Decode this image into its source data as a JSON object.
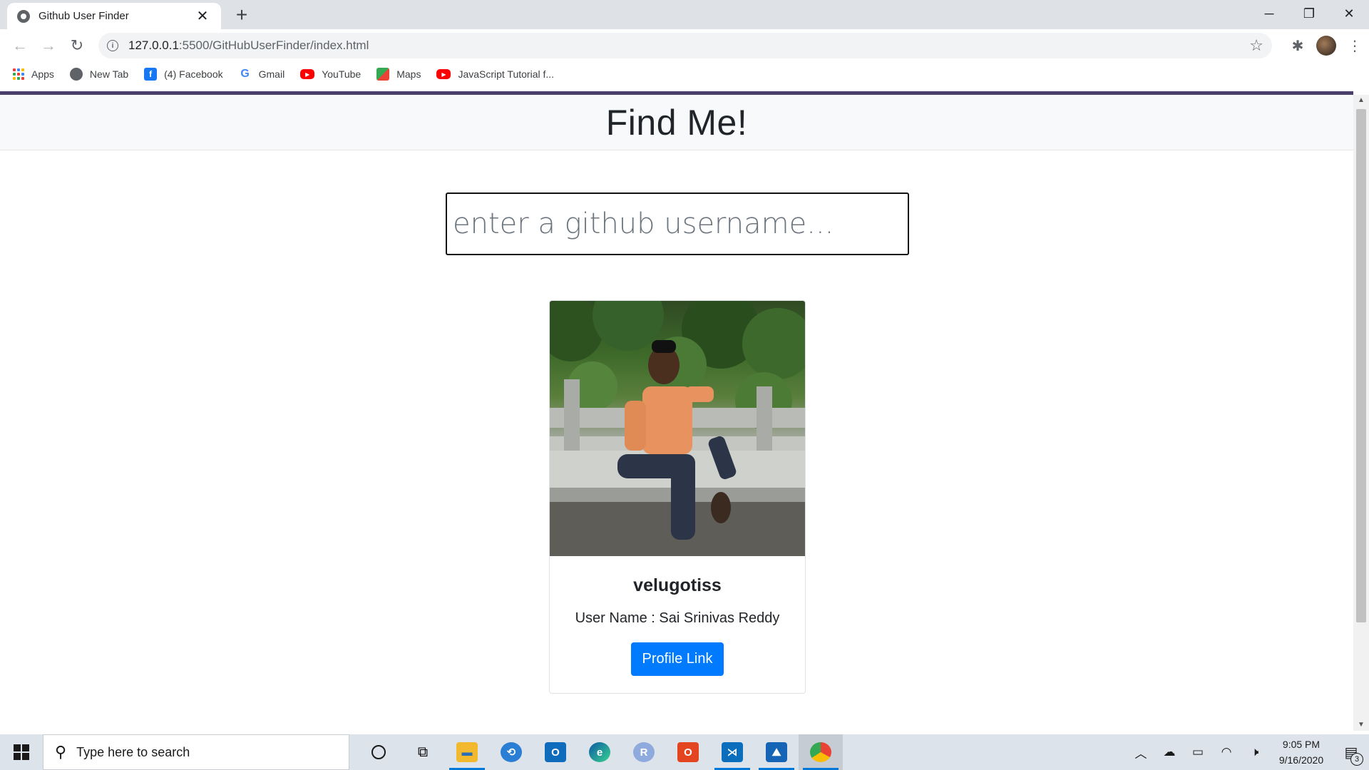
{
  "browser": {
    "tab_title": "Github User Finder",
    "tab_close": "✕",
    "new_tab": "+",
    "url_host": "127.0.0.1",
    "url_path": ":5500/GitHubUserFinder/index.html",
    "window_controls": [
      "─",
      "❐",
      "✕"
    ]
  },
  "bookmarks": [
    {
      "label": "Apps",
      "icon": "apps-grid-icon"
    },
    {
      "label": "New Tab",
      "icon": "globe-icon"
    },
    {
      "label": "(4) Facebook",
      "icon": "facebook-icon"
    },
    {
      "label": "Gmail",
      "icon": "google-icon"
    },
    {
      "label": "YouTube",
      "icon": "youtube-icon"
    },
    {
      "label": "Maps",
      "icon": "maps-icon"
    },
    {
      "label": "JavaScript Tutorial f...",
      "icon": "youtube-icon"
    }
  ],
  "page": {
    "title": "Find Me!",
    "search_placeholder": "enter a github username...",
    "search_value": "",
    "card": {
      "login": "velugotiss",
      "user_name": "User Name : Sai Srinivas Reddy",
      "button_label": "Profile Link"
    }
  },
  "taskbar": {
    "search_placeholder": "Type here to search",
    "time": "9:05 PM",
    "date": "9/16/2020",
    "notification_count": "3"
  },
  "colors": {
    "accent": "#007bff",
    "page_border": "#4b3f6b",
    "header_bg": "#f8f9fa"
  }
}
